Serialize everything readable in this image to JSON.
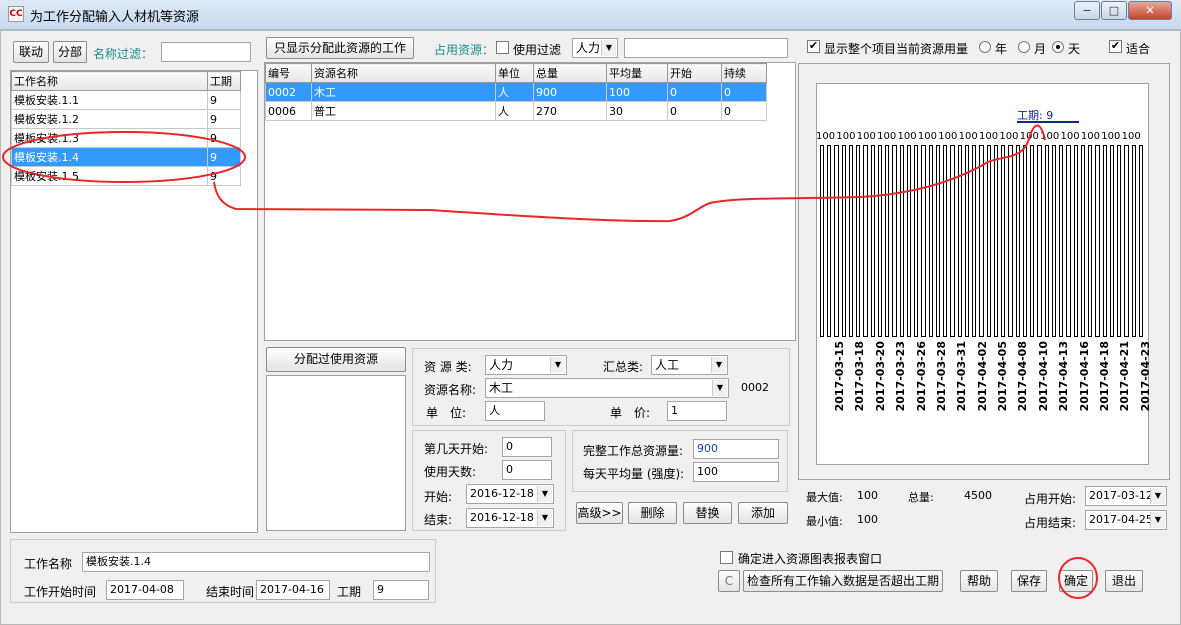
{
  "window": {
    "title": "为工作分配输入人材机等资源",
    "icon_text": "CC",
    "minimize": "−",
    "maximize": "□",
    "close": "✕"
  },
  "left": {
    "link_btn": "联动",
    "split_btn": "分部",
    "filter_label": "名称过滤：",
    "filter_value": "",
    "columns": [
      "工作名称",
      "工期"
    ],
    "rows": [
      {
        "name": "模板安装.1.1",
        "dur": "9"
      },
      {
        "name": "模板安装.1.2",
        "dur": "9"
      },
      {
        "name": "模板安装.1.3",
        "dur": "9"
      },
      {
        "name": "模板安装.1.4",
        "dur": "9"
      },
      {
        "name": "模板安装.1.5",
        "dur": "9"
      }
    ],
    "selected_row": 3
  },
  "middle": {
    "only_show_btn": "只显示分配此资源的工作",
    "occupy_label": "占用资源：",
    "use_filter_label": "使用过滤",
    "filter_type": "人力",
    "filter_text": "",
    "columns": [
      "编号",
      "资源名称",
      "单位",
      "总量",
      "平均量",
      "开始",
      "持续"
    ],
    "rows": [
      [
        "0002",
        "木工",
        "人",
        "900",
        "100",
        "0",
        "0"
      ],
      [
        "0006",
        "普工",
        "人",
        "270",
        "30",
        "0",
        "0"
      ]
    ],
    "selected_row": 0,
    "assigned_title": "分配过使用资源",
    "form": {
      "res_type_label": "资 源 类:",
      "res_type": "人力",
      "sum_type_label": "汇总类:",
      "sum_type": "人工",
      "res_name_label": "资源名称:",
      "res_name": "木工",
      "res_code": "0002",
      "unit_label": "单　位:",
      "unit": "人",
      "price_label": "单　价:",
      "price": "1",
      "start_day_label": "第几天开始:",
      "start_day": "0",
      "use_days_label": "使用天数:",
      "use_days": "0",
      "start_label": "开始:",
      "start": "2016-12-18",
      "end_label": "结束:",
      "end": "2016-12-18",
      "total_label": "完整工作总资源量:",
      "total": "900",
      "daily_label": "每天平均量 (强度):",
      "daily": "100",
      "adv_btn": "高级>>",
      "del_btn": "删除",
      "replace_btn": "替换",
      "add_btn": "添加"
    }
  },
  "right": {
    "show_all_label": "显示整个项目当前资源用量",
    "year": "年",
    "month": "月",
    "day": "天",
    "fit_label": "适合",
    "max_label": "最大值:",
    "max": "100",
    "min_label": "最小值:",
    "min": "100",
    "total_label": "总量:",
    "total": "4500",
    "occ_start_label": "占用开始:",
    "occ_start": "2017-03-12",
    "occ_end_label": "占用结束:",
    "occ_end": "2017-04-25"
  },
  "chart_data": {
    "type": "bar",
    "annotation": "工期: 9",
    "bar_count": 45,
    "value": 100,
    "bar_labels": [
      "100",
      "100",
      "100",
      "100",
      "100",
      "100",
      "100",
      "100",
      "100",
      "100",
      "100",
      "100",
      "100",
      "100",
      "100",
      "100"
    ],
    "date_labels": [
      "2017-03-15",
      "2017-03-18",
      "2017-03-20",
      "2017-03-23",
      "2017-03-26",
      "2017-03-28",
      "2017-03-31",
      "2017-04-02",
      "2017-04-05",
      "2017-04-08",
      "2017-04-10",
      "2017-04-13",
      "2017-04-16",
      "2017-04-18",
      "2017-04-21",
      "2017-04-23"
    ]
  },
  "bottom": {
    "work_name_label": "工作名称",
    "work_name": "模板安装.1.4",
    "start_label": "工作开始时间",
    "start": "2017-04-08",
    "end_label": "结束时间",
    "end": "2017-04-16",
    "dur_label": "工期",
    "dur": "9",
    "enter_chart_label": "确定进入资源图表报表窗口",
    "c_btn": "C",
    "check_btn": "检查所有工作输入数据是否超出工期",
    "help_btn": "帮助",
    "save_btn": "保存",
    "ok_btn": "确定",
    "exit_btn": "退出"
  }
}
